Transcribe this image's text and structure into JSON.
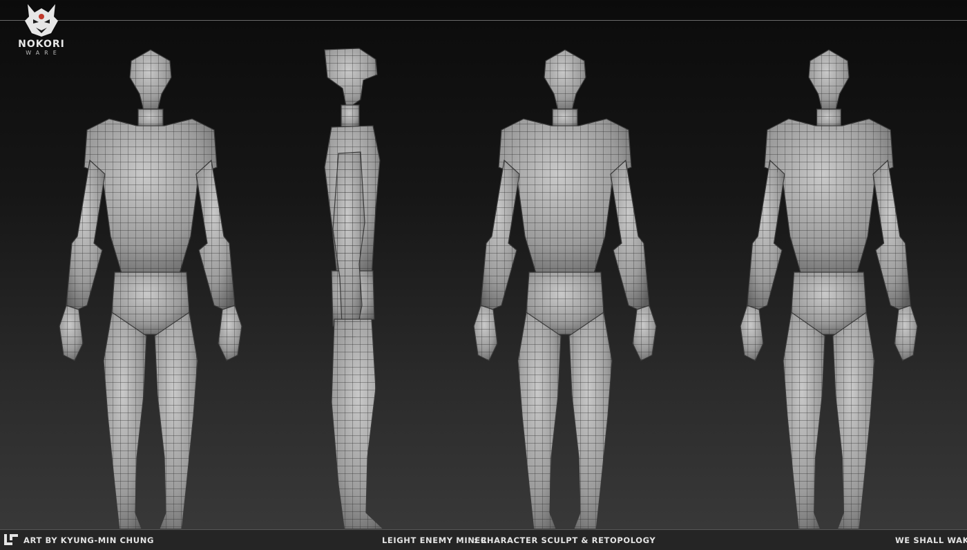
{
  "brand": {
    "name": "NOKORI",
    "sub": "WARE"
  },
  "footer": {
    "credit": "ART BY KYUNG-MIN CHUNG",
    "project": "LEIGHT ENEMY MINER",
    "description": ": CHARACTER SCULPT & RETOPOLOGY",
    "tagline": "WE SHALL WAKE"
  },
  "image": {
    "views": [
      "front",
      "side",
      "back",
      "three-quarter"
    ],
    "colors": {
      "background_top": "#0b0b0b",
      "background_bottom": "#3a3a3a",
      "mesh_fill": "#a9a9a9",
      "mesh_line": "#2a2a2a",
      "brand_accent": "#c0392b"
    }
  }
}
